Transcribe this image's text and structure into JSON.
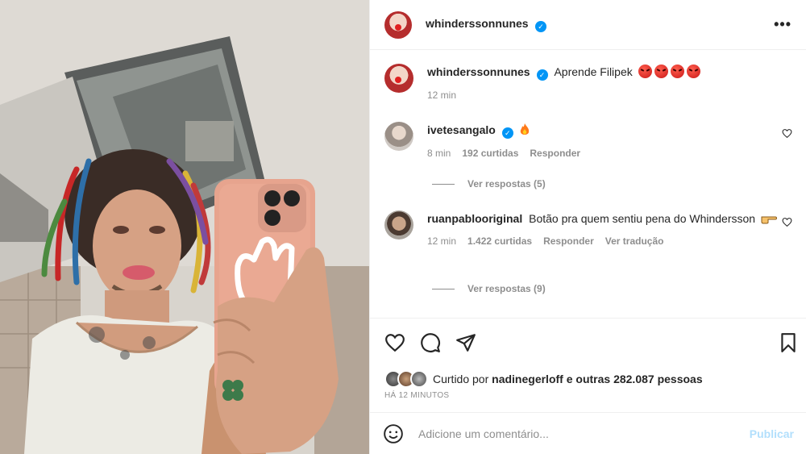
{
  "post": {
    "author": "whinderssonnunes",
    "caption": "Aprende Filipek",
    "caption_emoji": "angry-face-emoji",
    "caption_emoji_count": 4,
    "caption_time": "12 min"
  },
  "comments": [
    {
      "username": "ivetesangalo",
      "text": "",
      "emoji": "fire-emoji",
      "time": "8 min",
      "likes": "192 curtidas",
      "reply": "Responder",
      "translate": "",
      "view_replies": "Ver respostas (5)"
    },
    {
      "username": "ruanpablooriginal",
      "text": "Botão pra quem sentiu pena do Whindersson",
      "emoji": "pointing-hand-emoji",
      "time": "12 min",
      "likes": "1.422 curtidas",
      "reply": "Responder",
      "translate": "Ver tradução",
      "view_replies": "Ver respostas (9)"
    }
  ],
  "likes": {
    "prefix": "Curtido por",
    "user": "nadinegerloff",
    "suffix": "e outras 282.087 pessoas"
  },
  "timestamp": "HÁ 12 MINUTOS",
  "add_comment": {
    "placeholder": "Adicione um comentário...",
    "publish": "Publicar"
  },
  "colors": {
    "verified": "#0095f6",
    "muted_text": "#8e8e8e",
    "publish_disabled": "#b2dffc",
    "divider": "#efefef"
  }
}
